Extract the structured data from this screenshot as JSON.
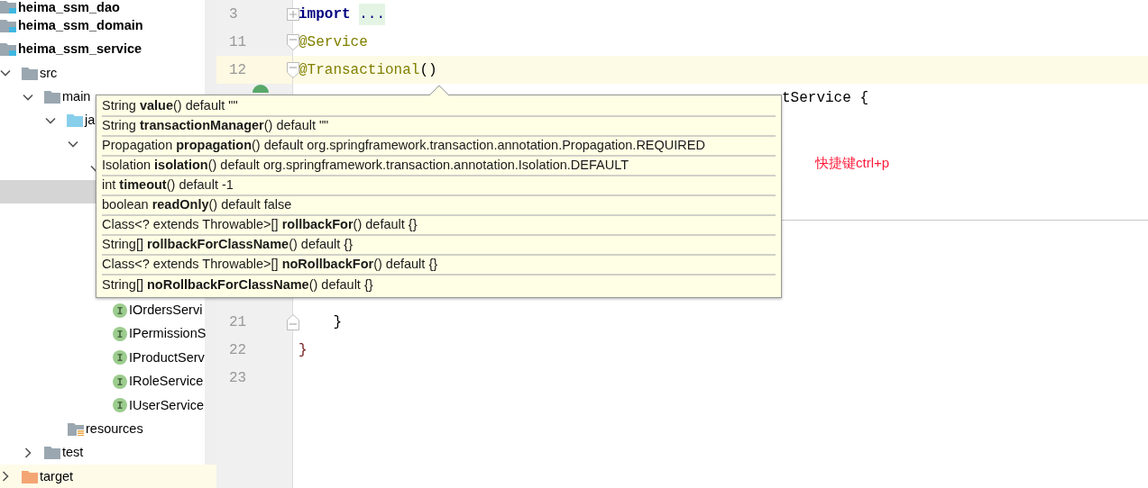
{
  "project_tree": [
    {
      "label": "heima_ssm_dao",
      "kind": "module",
      "selected": false,
      "highlighted": false
    },
    {
      "label": "heima_ssm_domain",
      "kind": "module",
      "selected": false,
      "highlighted": false
    },
    {
      "label": "heima_ssm_service",
      "kind": "module",
      "selected": false,
      "highlighted": false,
      "children": [
        {
          "label": "src",
          "kind": "folder",
          "expanded": true,
          "selected": false,
          "highlighted": false,
          "children": [
            {
              "label": "main",
              "kind": "folder",
              "expanded": true,
              "selected": false,
              "highlighted": false,
              "children": [
                {
                  "label": "ja",
                  "kind": "source_folder",
                  "expanded": true,
                  "selected": false,
                  "highlighted": false,
                  "children": [
                    {
                      "expanded": true,
                      "selected": false,
                      "highlighted": false,
                      "children": [
                        {
                          "expanded": true,
                          "selected": false,
                          "highlighted": false,
                          "children": [
                            {
                              "selected": true,
                              "highlighted": false
                            },
                            {
                              "selected": false,
                              "highlighted": false
                            },
                            {
                              "selected": false,
                              "highlighted": false
                            },
                            {
                              "selected": false,
                              "highlighted": false
                            },
                            {
                              "selected": false,
                              "highlighted": false
                            }
                          ]
                        },
                        {
                          "label": "IOrdersServi",
                          "kind": "interface",
                          "selected": false,
                          "highlighted": false
                        },
                        {
                          "label": "IPermissionS",
                          "kind": "interface",
                          "selected": false,
                          "highlighted": false
                        },
                        {
                          "label": "IProductServ",
                          "kind": "interface",
                          "selected": false,
                          "highlighted": false
                        },
                        {
                          "label": "IRoleService",
                          "kind": "interface",
                          "selected": false,
                          "highlighted": false
                        },
                        {
                          "label": "IUserService",
                          "kind": "interface",
                          "selected": false,
                          "highlighted": false
                        }
                      ]
                    }
                  ]
                },
                {
                  "label": "resources",
                  "kind": "resources_folder",
                  "selected": false,
                  "highlighted": false
                }
              ]
            },
            {
              "label": "test",
              "kind": "folder",
              "expanded": false,
              "selected": false,
              "highlighted": false
            }
          ]
        },
        {
          "label": "target",
          "kind": "excluded_folder",
          "expanded": false,
          "selected": false,
          "highlighted": true
        }
      ]
    }
  ],
  "editor": {
    "lines_above": [
      {
        "number": "3",
        "kind": "fold_collapsed",
        "current": false,
        "tokens": [
          {
            "kind": "keyword",
            "text": "import"
          },
          {
            "kind": "folded",
            "text": "..."
          }
        ]
      },
      {
        "number": "11",
        "kind": "fold_start",
        "current": false,
        "tokens": [
          {
            "kind": "annotation",
            "text": "@Service"
          }
        ]
      },
      {
        "number": "12",
        "kind": "fold_start",
        "current": true,
        "tokens": [
          {
            "kind": "annotation",
            "text": "@Transactional"
          },
          {
            "kind": "plain",
            "text": "()"
          }
        ]
      },
      {
        "kind": "run",
        "current": false,
        "tokens": [
          {
            "kind": "tail",
            "text": "tService {"
          }
        ]
      }
    ],
    "lines_below": [
      {
        "number": "21",
        "kind": "fold_end",
        "current": false,
        "tokens": [
          {
            "kind": "indented",
            "text": "}"
          }
        ]
      },
      {
        "number": "22",
        "kind": "plain",
        "current": false,
        "tokens": [
          {
            "kind": "brace",
            "text": "}"
          }
        ]
      },
      {
        "number": "23",
        "kind": "plain",
        "current": false
      }
    ]
  },
  "note": "快捷键ctrl+p",
  "parameter_info": [
    "String **value**() default \"\"",
    "String **transactionManager**() default \"\"",
    "Propagation **propagation**() default org.springframework.transaction.annotation.Propagation.REQUIRED",
    "Isolation **isolation**() default org.springframework.transaction.annotation.Isolation.DEFAULT",
    "int **timeout**() default -1",
    "boolean **readOnly**() default false",
    "Class<? extends Throwable>[] **rollbackFor**() default {}",
    "String[] **rollbackForClassName**() default {}",
    "Class<? extends Throwable>[] **noRollbackFor**() default {}",
    "String[] **noRollbackForClassName**() default {}"
  ]
}
